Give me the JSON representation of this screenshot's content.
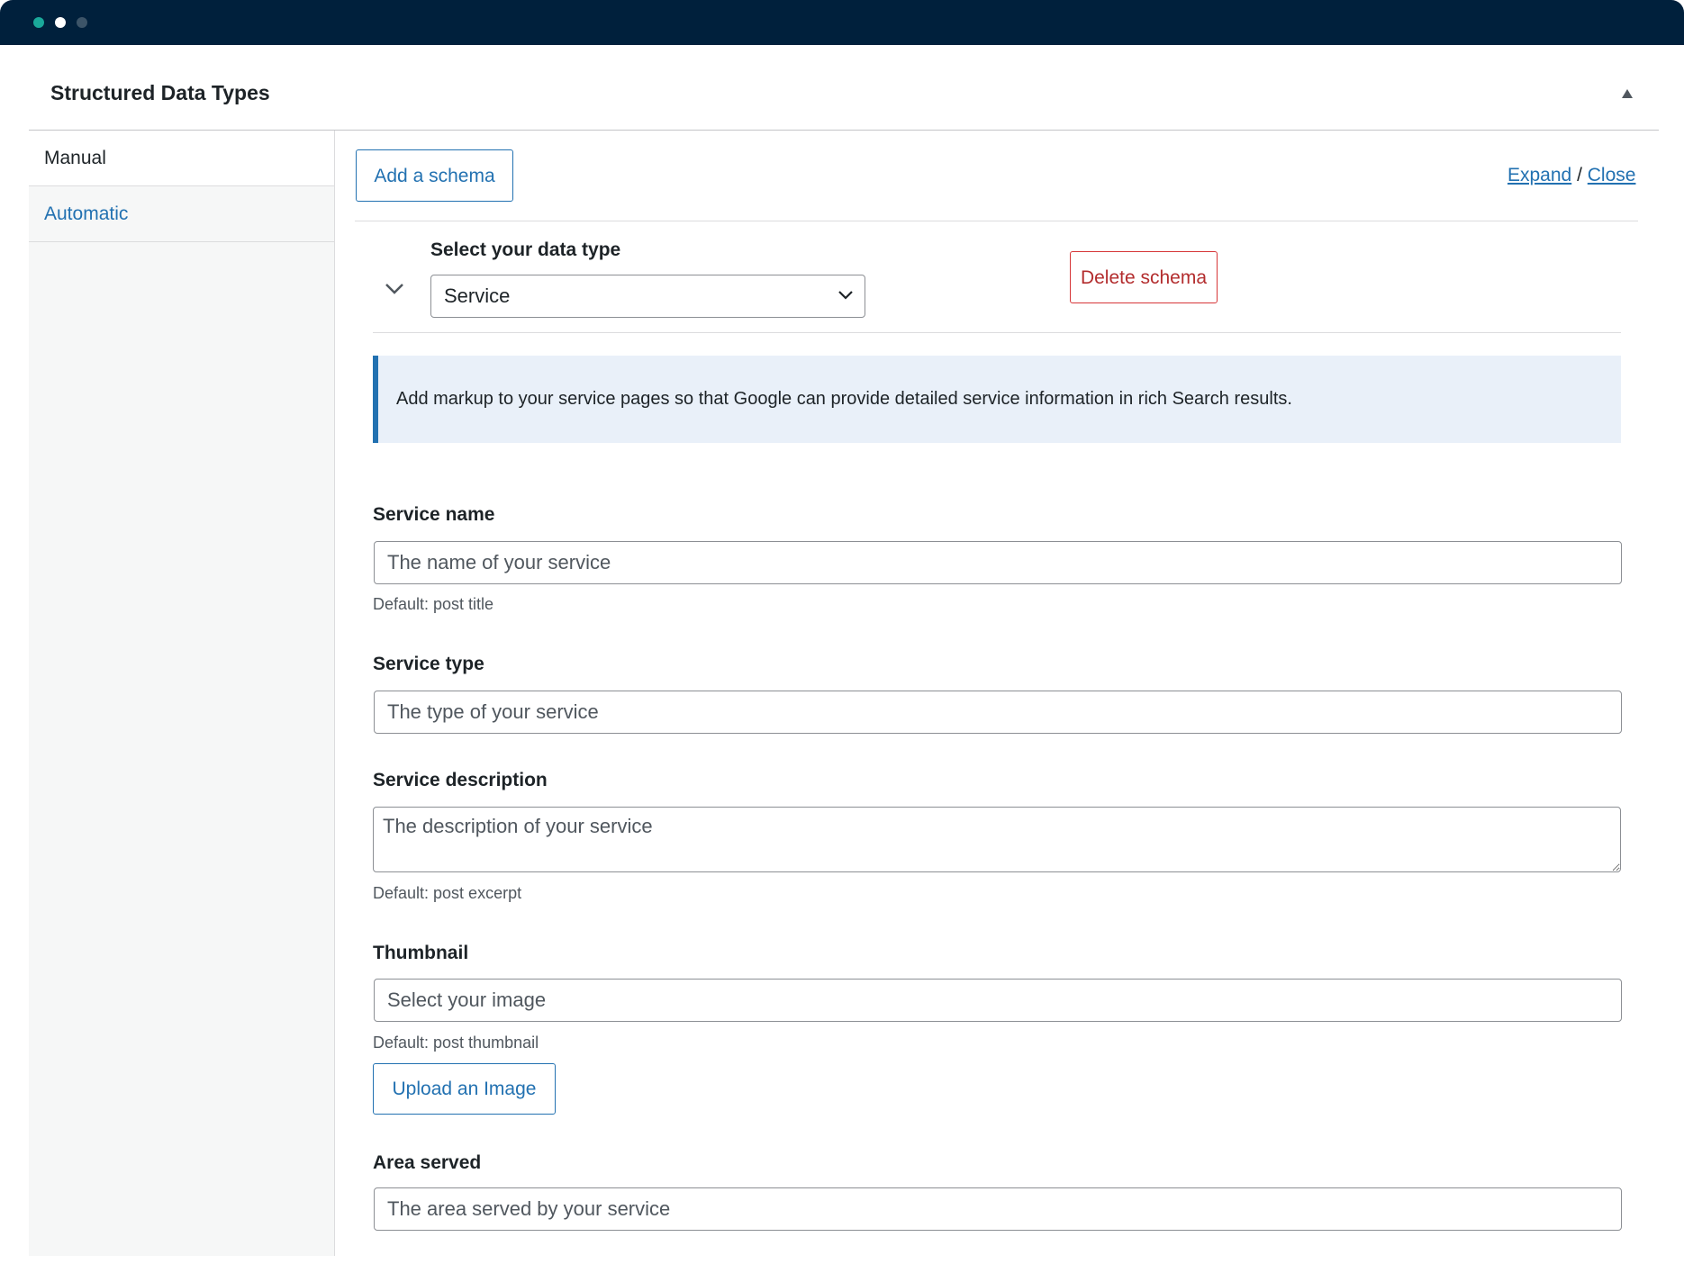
{
  "window": {
    "traffic_lights": [
      "green",
      "white",
      "gray"
    ]
  },
  "panel": {
    "title": "Structured Data Types"
  },
  "sidebar": {
    "items": [
      {
        "label": "Manual",
        "active": true
      },
      {
        "label": "Automatic",
        "active": false
      }
    ]
  },
  "toolbar": {
    "add_schema_label": "Add a schema",
    "expand_label": "Expand",
    "separator": "/",
    "close_label": "Close"
  },
  "schema": {
    "select_label": "Select your data type",
    "selected_type": "Service",
    "delete_label": "Delete schema",
    "notice": "Add markup to your service pages so that Google can provide detailed service information in rich Search results."
  },
  "fields": {
    "service_name": {
      "label": "Service name",
      "placeholder": "The name of your service",
      "value": "",
      "help": "Default: post title"
    },
    "service_type": {
      "label": "Service type",
      "placeholder": "The type of your service",
      "value": ""
    },
    "service_description": {
      "label": "Service description",
      "placeholder": "The description of your service",
      "value": "",
      "help": "Default: post excerpt"
    },
    "thumbnail": {
      "label": "Thumbnail",
      "placeholder": "Select your image",
      "value": "",
      "help": "Default: post thumbnail",
      "upload_label": "Upload an Image"
    },
    "area_served": {
      "label": "Area served",
      "placeholder": "The area served by your service",
      "value": ""
    }
  },
  "colors": {
    "titlebar": "#00203c",
    "accent": "#2271b1",
    "danger": "#d63638",
    "notice_bg": "#e9f0f9"
  }
}
